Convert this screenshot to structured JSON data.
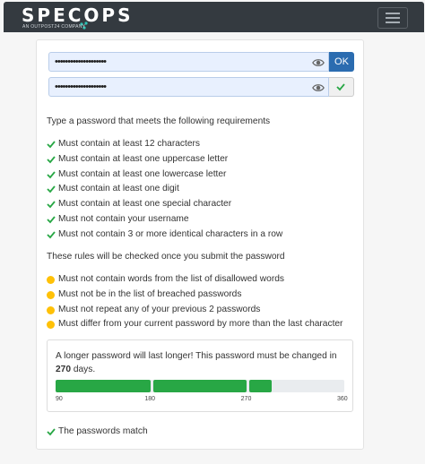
{
  "brand": {
    "name": "SPECOPS",
    "tagline": "AN OUTPOST24 COMPANY"
  },
  "colors": {
    "accent": "#28a745",
    "pending": "#ffc107",
    "primary": "#2b6cb0",
    "navbar": "#343a40"
  },
  "fields": {
    "new_password": {
      "value": "••••••••••••••••••••",
      "button_label": "OK"
    },
    "confirm_password": {
      "value": "••••••••••••••••••••"
    }
  },
  "intro": "Type a password that meets the following requirements",
  "requirements": [
    "Must contain at least 12 characters",
    "Must contain at least one uppercase letter",
    "Must contain at least one lowercase letter",
    "Must contain at least one digit",
    "Must contain at least one special character",
    "Must not contain your username",
    "Must not contain 3 or more identical characters in a row"
  ],
  "deferred_intro": "These rules will be checked once you submit the password",
  "deferred_rules": [
    "Must not contain words from the list of disallowed words",
    "Must not be in the list of breached passwords",
    "Must not repeat any of your previous 2 passwords",
    "Must differ from your current password by more than the last character"
  ],
  "strength": {
    "text_before": "A longer password will last longer! This password must be changed in",
    "days": "270",
    "text_after": "days.",
    "value_days": 270,
    "max_days": 360,
    "ticks": [
      "90",
      "180",
      "270",
      "360"
    ]
  },
  "match_text": "The passwords match"
}
